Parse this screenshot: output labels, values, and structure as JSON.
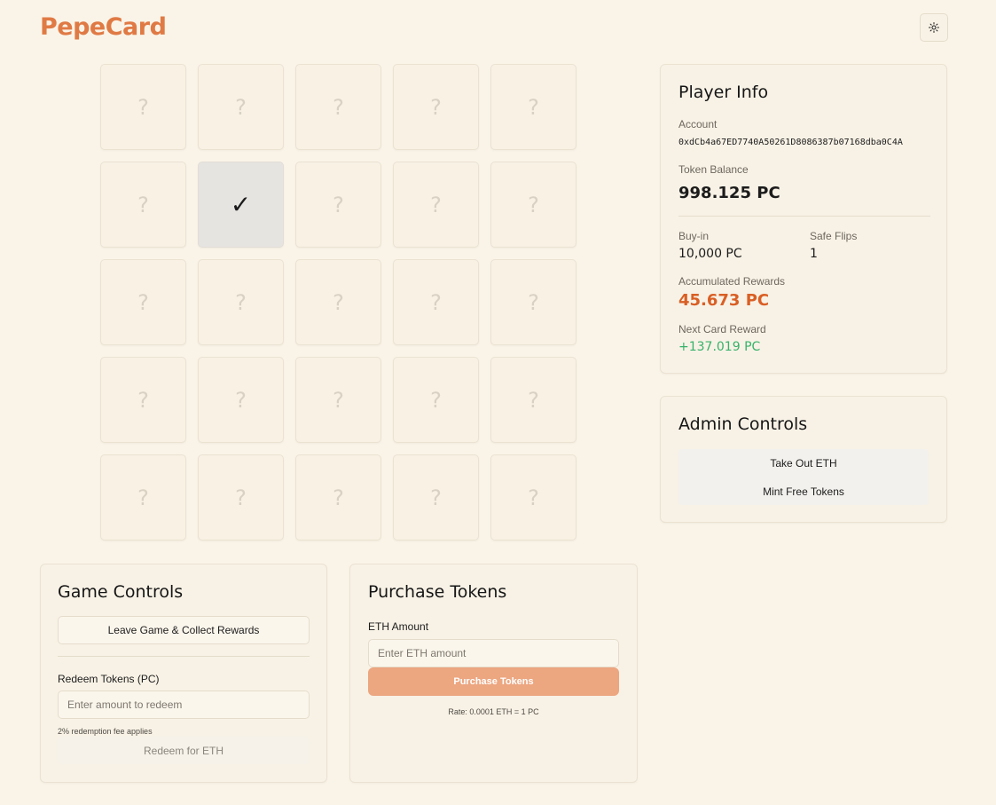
{
  "app": {
    "logo": "PepeCard"
  },
  "header": {
    "theme_toggle_icon": "sun-icon"
  },
  "board": {
    "cards": [
      "?",
      "?",
      "?",
      "?",
      "?",
      "?",
      "✓",
      "?",
      "?",
      "?",
      "?",
      "?",
      "?",
      "?",
      "?",
      "?",
      "?",
      "?",
      "?",
      "?",
      "?",
      "?",
      "?",
      "?",
      "?"
    ],
    "revealed_index": 6
  },
  "player_info": {
    "title": "Player Info",
    "account_label": "Account",
    "account": "0xdCb4a67ED7740A50261D8086387b07168dba0C4A",
    "balance_label": "Token Balance",
    "balance": "998.125 PC",
    "buyin_label": "Buy-in",
    "buyin": "10,000 PC",
    "safe_flips_label": "Safe Flips",
    "safe_flips": "1",
    "accumulated_label": "Accumulated Rewards",
    "accumulated": "45.673 PC",
    "next_label": "Next Card Reward",
    "next": "+137.019 PC"
  },
  "admin": {
    "title": "Admin Controls",
    "take_out": "Take Out ETH",
    "mint": "Mint Free Tokens"
  },
  "game_controls": {
    "title": "Game Controls",
    "leave": "Leave Game & Collect Rewards",
    "redeem_label": "Redeem Tokens (PC)",
    "redeem_placeholder": "Enter amount to redeem",
    "fee_note": "2% redemption fee applies",
    "redeem_button": "Redeem for ETH"
  },
  "purchase": {
    "title": "Purchase Tokens",
    "eth_label": "ETH Amount",
    "eth_placeholder": "Enter ETH amount",
    "button": "Purchase Tokens",
    "rate": "Rate: 0.0001 ETH = 1 PC"
  },
  "colors": {
    "accent": "#e07a45",
    "reward": "#d95f25",
    "positive": "#37b26a",
    "button_orange": "#eca680",
    "background": "#faf4e8"
  }
}
